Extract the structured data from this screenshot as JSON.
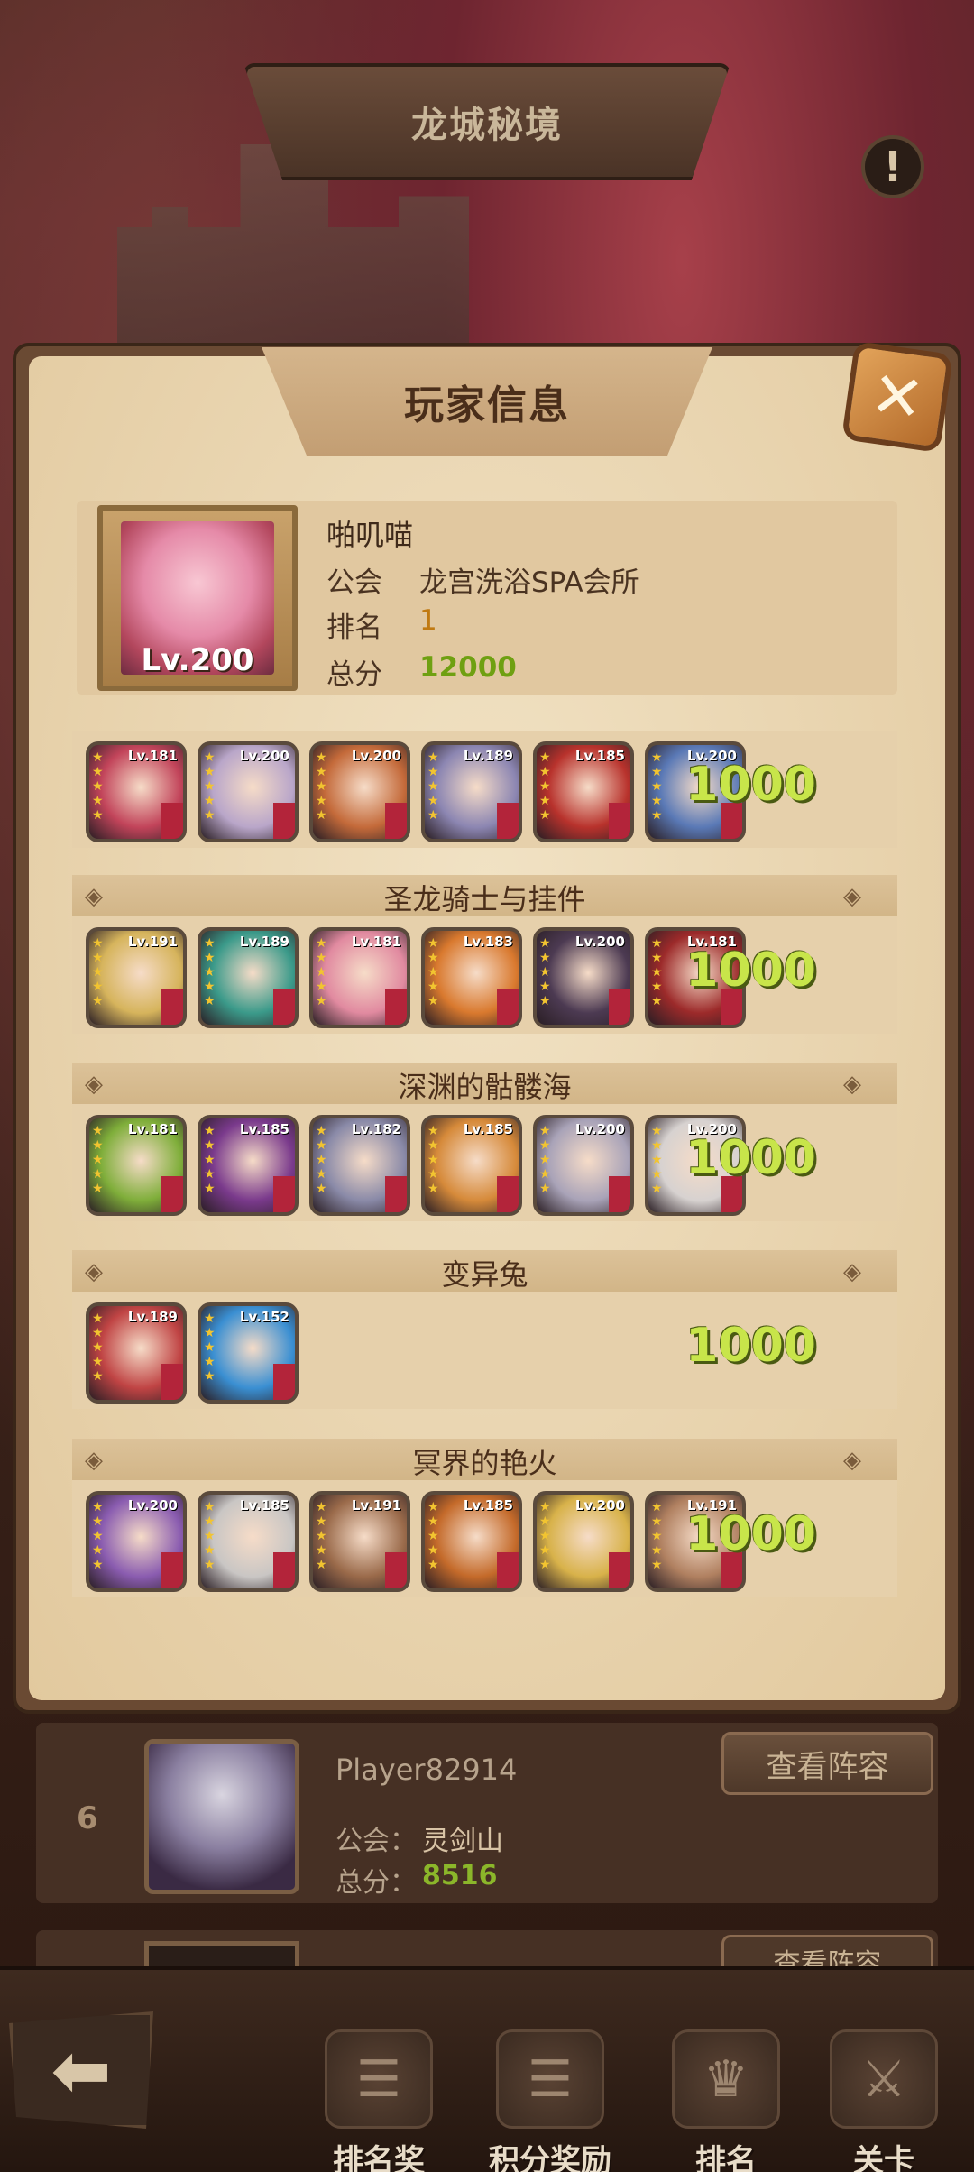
{
  "header": {
    "title": "龙城秘境",
    "info_icon": "!"
  },
  "modal": {
    "title": "玩家信息",
    "close_icon": "✕",
    "player": {
      "name": "啪叽喵",
      "level": "Lv.200",
      "guild_label": "公会",
      "guild": "龙宫洗浴SPA会所",
      "rank_label": "排名",
      "rank": "1",
      "total_label": "总分",
      "total": "12000"
    },
    "teams": [
      {
        "name": "",
        "score": "1000",
        "heroes": [
          {
            "level": "Lv.181",
            "color": "#c2445a"
          },
          {
            "level": "Lv.200",
            "color": "#b9a6c9"
          },
          {
            "level": "Lv.200",
            "color": "#c46a3a"
          },
          {
            "level": "Lv.189",
            "color": "#8c86b2"
          },
          {
            "level": "Lv.185",
            "color": "#b8322c"
          },
          {
            "level": "Lv.200",
            "color": "#5a79b6"
          }
        ]
      },
      {
        "name": "圣龙骑士与挂件",
        "score": "1000",
        "heroes": [
          {
            "level": "Lv.191",
            "color": "#d6b45c"
          },
          {
            "level": "Lv.189",
            "color": "#3b9a8a"
          },
          {
            "level": "Lv.181",
            "color": "#e18aa0"
          },
          {
            "level": "Lv.183",
            "color": "#d9792e"
          },
          {
            "level": "Lv.200",
            "color": "#4c3a52"
          },
          {
            "level": "Lv.181",
            "color": "#9c2a2a"
          }
        ]
      },
      {
        "name": "深渊的骷髅海",
        "score": "1000",
        "heroes": [
          {
            "level": "Lv.181",
            "color": "#7fae3a"
          },
          {
            "level": "Lv.185",
            "color": "#7a3a8c"
          },
          {
            "level": "Lv.182",
            "color": "#8a8aa8"
          },
          {
            "level": "Lv.185",
            "color": "#d68a3a"
          },
          {
            "level": "Lv.200",
            "color": "#a9a3b8"
          },
          {
            "level": "Lv.200",
            "color": "#d7d2d0"
          }
        ]
      },
      {
        "name": "变异兔",
        "score": "1000",
        "heroes": [
          {
            "level": "Lv.189",
            "color": "#c04444"
          },
          {
            "level": "Lv.152",
            "color": "#3a8fd2"
          }
        ]
      },
      {
        "name": "冥界的艳火",
        "score": "1000",
        "heroes": [
          {
            "level": "Lv.200",
            "color": "#8a5cb0"
          },
          {
            "level": "Lv.185",
            "color": "#c9c6c4"
          },
          {
            "level": "Lv.191",
            "color": "#9a6a4a"
          },
          {
            "level": "Lv.185",
            "color": "#c46a2a"
          },
          {
            "level": "Lv.200",
            "color": "#d8b24a"
          },
          {
            "level": "Lv.191",
            "color": "#b08060"
          }
        ]
      }
    ]
  },
  "ranking_list": {
    "item": {
      "rank": "6",
      "name": "Player82914",
      "guild_label": "公会：",
      "guild": "灵剑山",
      "score_label": "总分：",
      "score": "8516",
      "view_button": "查看阵容"
    },
    "next_view_button": "查看阵容"
  },
  "bottom_nav": {
    "back_icon": "⬅",
    "items": [
      {
        "label": "排名奖",
        "icon": "☰"
      },
      {
        "label": "积分奖励",
        "icon": "☰"
      },
      {
        "label": "排名",
        "icon": "♛"
      },
      {
        "label": "关卡",
        "icon": "⚔"
      }
    ]
  }
}
